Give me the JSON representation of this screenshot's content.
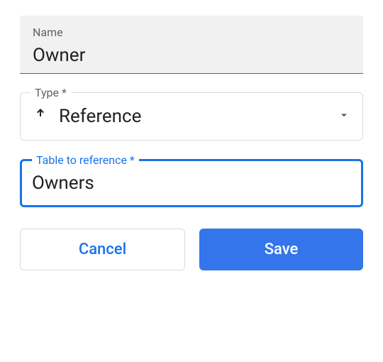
{
  "nameField": {
    "label": "Name",
    "value": "Owner"
  },
  "typeField": {
    "label": "Type *",
    "value": "Reference"
  },
  "tableField": {
    "label": "Table to reference *",
    "value": "Owners"
  },
  "buttons": {
    "cancel": "Cancel",
    "save": "Save"
  }
}
